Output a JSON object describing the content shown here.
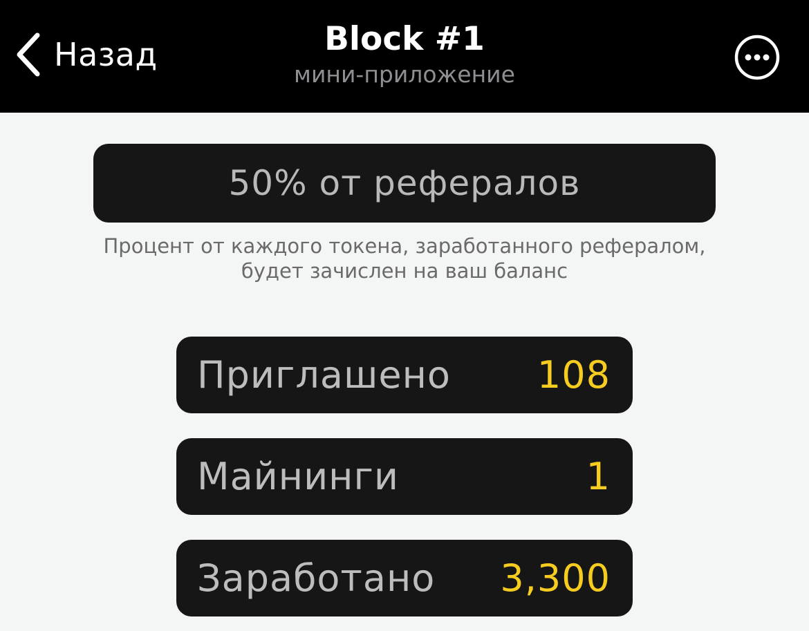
{
  "header": {
    "back_label": "Назад",
    "title": "Block #1",
    "subtitle": "мини-приложение",
    "icons": {
      "back": "chevron-left-icon",
      "more": "more-horizontal-icon"
    }
  },
  "referral": {
    "banner": "50% от рефералов",
    "description": "Процент от каждого токена, заработанного рефералом, будет зачислен на ваш баланс"
  },
  "stats": [
    {
      "label": "Приглашено",
      "value": "108"
    },
    {
      "label": "Майнинги",
      "value": "1"
    },
    {
      "label": "Заработано",
      "value": "3,300"
    }
  ],
  "colors": {
    "header_bg": "#000000",
    "card_bg": "#161616",
    "accent": "#f5cc1f",
    "page_bg": "#f4f6f5"
  }
}
